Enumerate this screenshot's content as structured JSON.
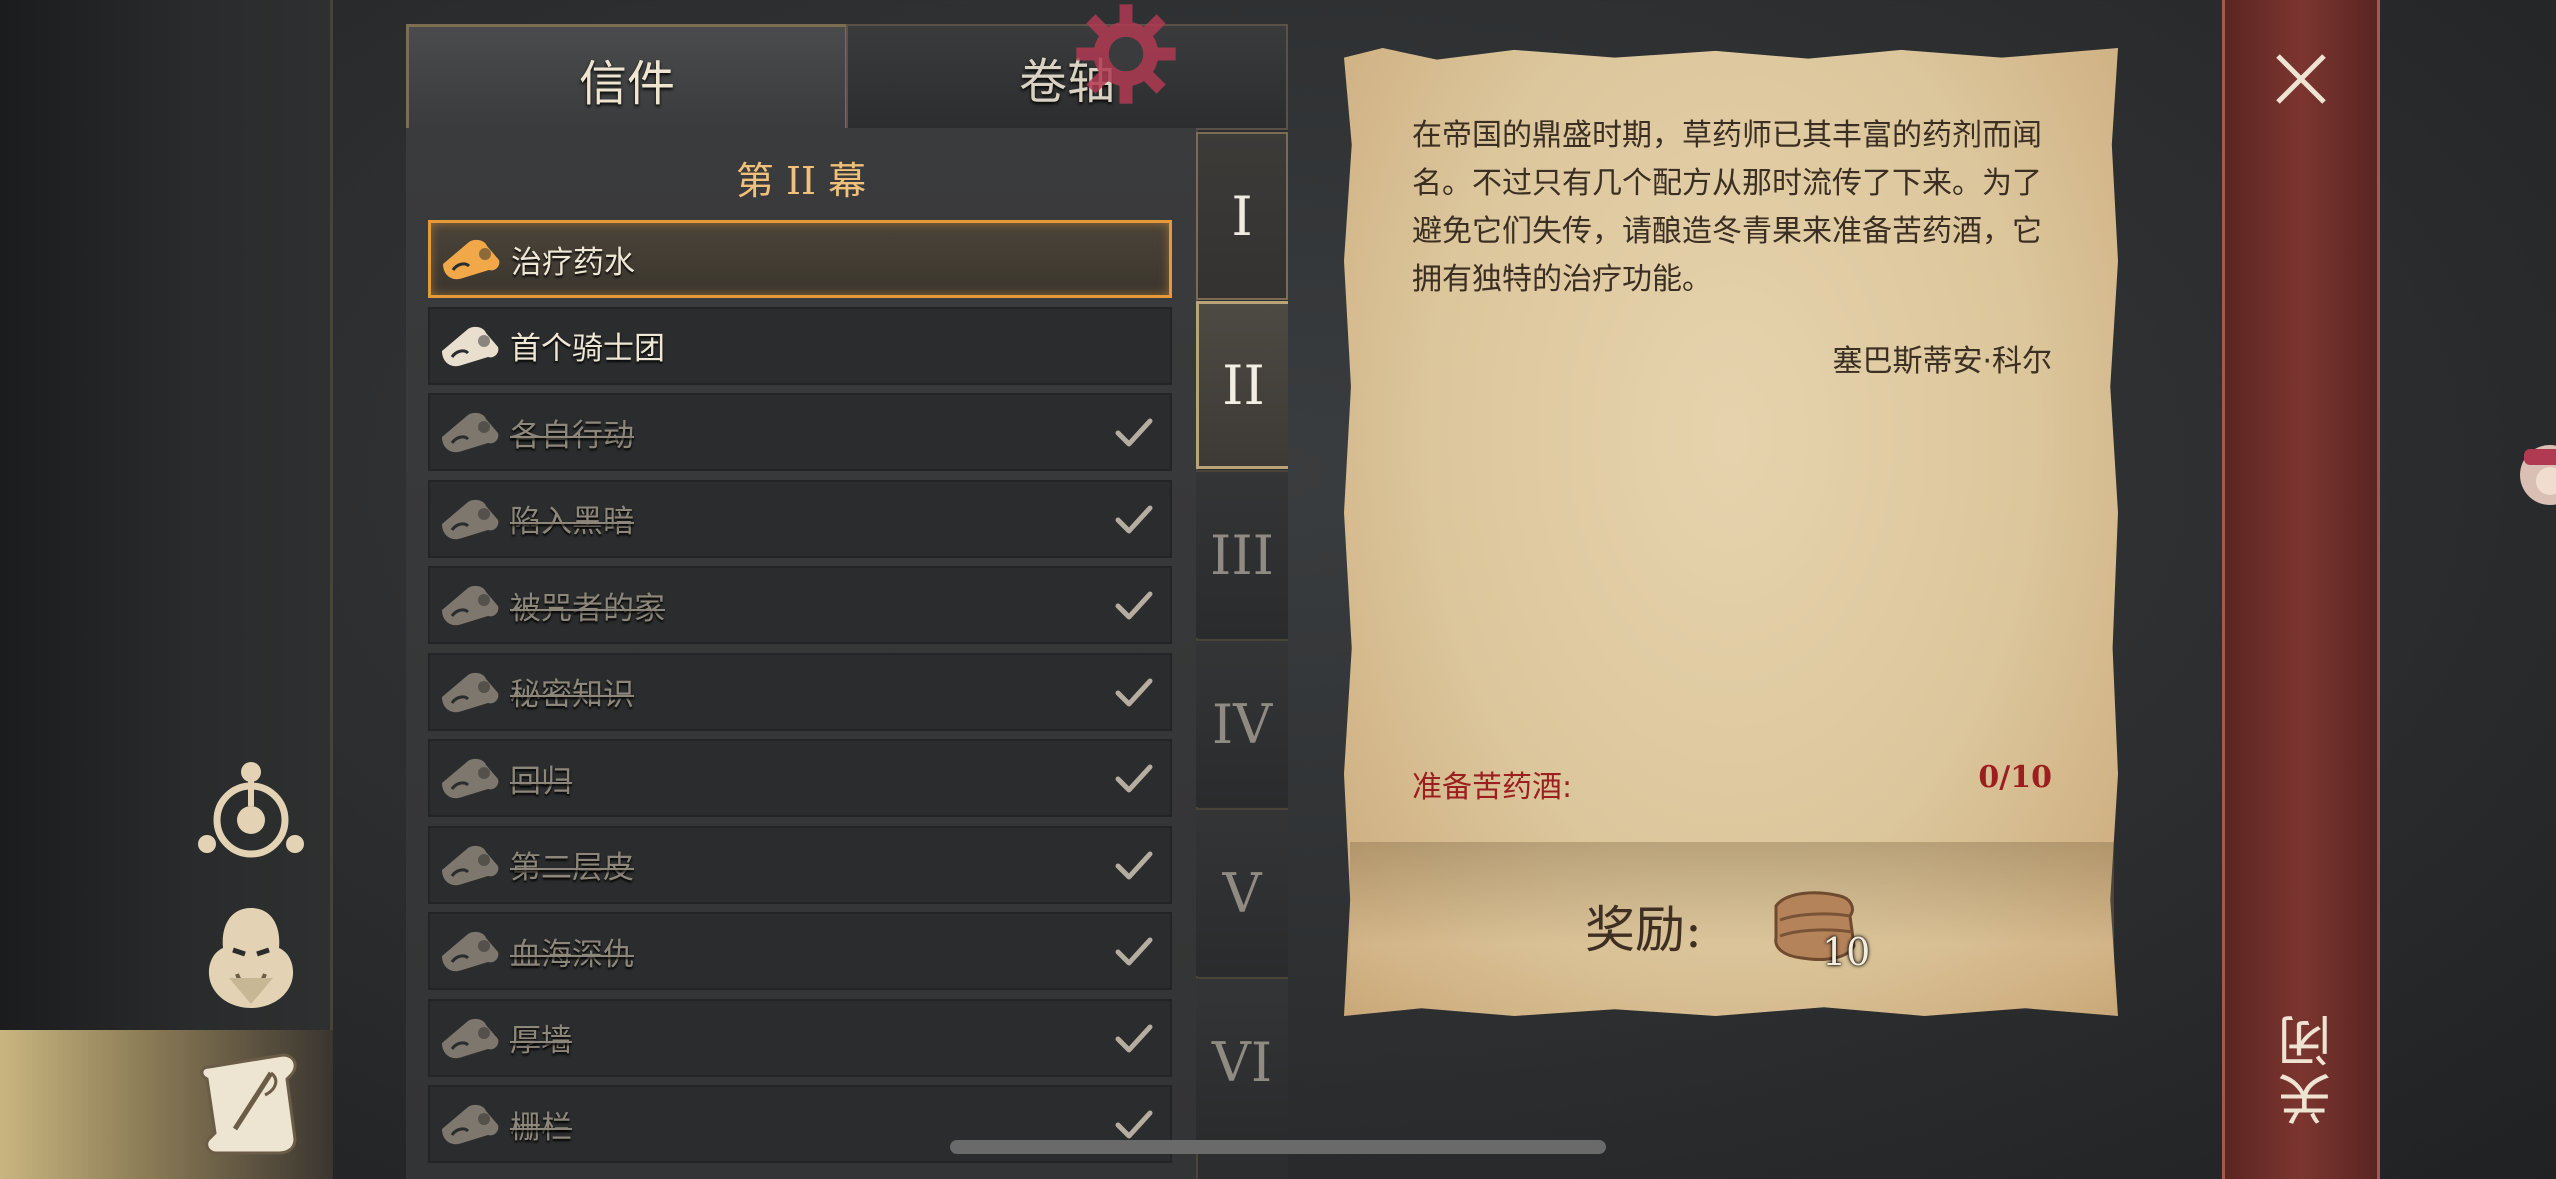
{
  "tabs": {
    "letters": "信件",
    "scrolls": "卷轴"
  },
  "act_title": "第 II 幕",
  "acts": [
    "I",
    "II",
    "III",
    "IV",
    "V",
    "VI"
  ],
  "active_act": "II",
  "quests": [
    {
      "label": "治疗药水",
      "state": "active"
    },
    {
      "label": "首个骑士团",
      "state": "open"
    },
    {
      "label": "各自行动",
      "state": "done"
    },
    {
      "label": "陷入黑暗",
      "state": "done"
    },
    {
      "label": "被咒者的家",
      "state": "done"
    },
    {
      "label": "秘密知识",
      "state": "done"
    },
    {
      "label": "回归",
      "state": "done"
    },
    {
      "label": "第二层皮",
      "state": "done"
    },
    {
      "label": "血海深仇",
      "state": "done"
    },
    {
      "label": "厚墙",
      "state": "done"
    },
    {
      "label": "栅栏",
      "state": "done"
    }
  ],
  "letter": {
    "body": "在帝国的鼎盛时期，草药师已其丰富的药剂而闻名。不过只有几个配方从那时流传了下来。为了避免它们失传，请酿造冬青果来准备苦药酒，它拥有独特的治疗功能。",
    "signature": "塞巴斯蒂安·科尔",
    "objective": "准备苦药酒:",
    "progress": "0/10"
  },
  "reward": {
    "label": "奖励:",
    "quantity": "10",
    "icon": "leather-icon"
  },
  "close": {
    "label": "关闭"
  },
  "colors": {
    "accent": "#e59a3a",
    "objective": "#9b1f1f",
    "close_bg": "#7c3530"
  }
}
